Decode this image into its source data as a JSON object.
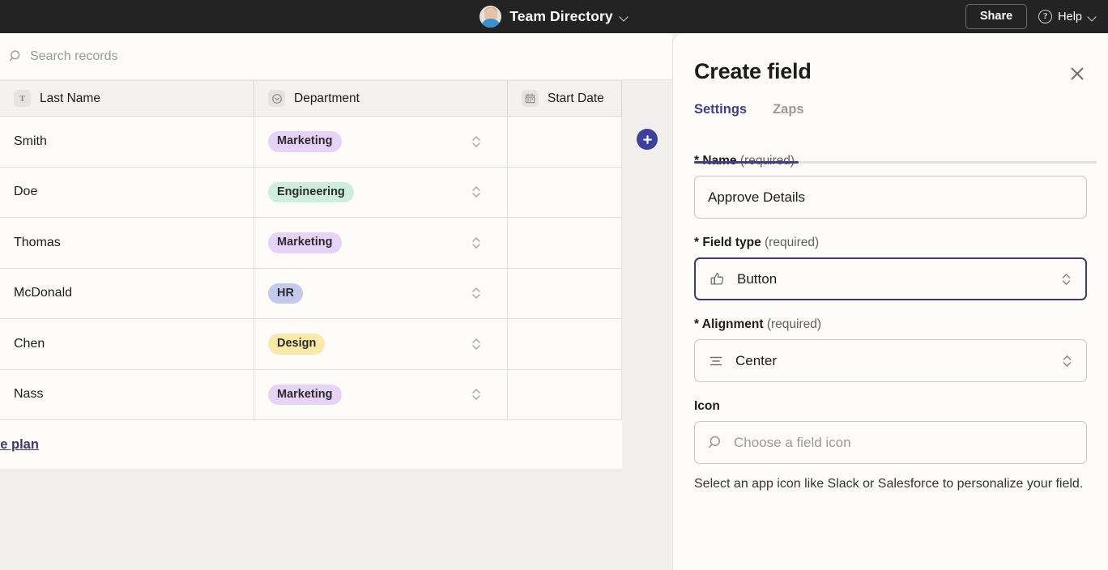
{
  "topbar": {
    "avatar_name": "avatar",
    "doc_title": "Team Directory",
    "title_caret_icon": "chevron-down-icon",
    "share_label": "Share",
    "help_label": "Help",
    "help_icon": "question-circle-icon",
    "help_caret_icon": "chevron-down-icon",
    "bg_color": "#232323"
  },
  "workspace": {
    "search": {
      "icon": "search-icon",
      "placeholder": "Search records",
      "value": ""
    },
    "add_field_button": {
      "icon": "plus-icon",
      "label": "",
      "color": "#3f3f9e"
    },
    "table": {
      "columns": [
        {
          "label": "Last Name",
          "icon": "text-field-icon",
          "glyph": "T"
        },
        {
          "label": "Department",
          "icon": "single-select-icon",
          "glyph": ""
        },
        {
          "label": "Start Date",
          "icon": "calendar-icon",
          "glyph": ""
        }
      ],
      "rows": [
        {
          "last_name": "Smith",
          "department": "Marketing",
          "badge_bg": "#e7d3f7",
          "badge_fg": "#2c2c2c",
          "start_date": ""
        },
        {
          "last_name": "Doe",
          "department": "Engineering",
          "badge_bg": "#cdeedd",
          "badge_fg": "#2c2c2c",
          "start_date": ""
        },
        {
          "last_name": "Thomas",
          "department": "Marketing",
          "badge_bg": "#e7d3f7",
          "badge_fg": "#2c2c2c",
          "start_date": ""
        },
        {
          "last_name": "McDonald",
          "department": "HR",
          "badge_bg": "#c3caec",
          "badge_fg": "#2c2c2c",
          "start_date": ""
        },
        {
          "last_name": "Chen",
          "department": "Design",
          "badge_bg": "#fae9a8",
          "badge_fg": "#2c2c2c",
          "start_date": ""
        },
        {
          "last_name": "Nass",
          "department": "Marketing",
          "badge_bg": "#e7d3f7",
          "badge_fg": "#2c2c2c",
          "start_date": ""
        }
      ],
      "upgrade_link": "ade plan"
    }
  },
  "panel": {
    "title": "Create field",
    "close_icon": "close-icon",
    "tabs": [
      {
        "label": "Settings",
        "active": true
      },
      {
        "label": "Zaps",
        "active": false
      }
    ],
    "accent_color": "#3f3f8e",
    "fields": {
      "name": {
        "label_bold": "* Name",
        "label_hint": "(required)",
        "value": "Approve Details",
        "placeholder": ""
      },
      "field_type": {
        "label_bold": "* Field type",
        "label_hint": "(required)",
        "value": "Button",
        "icon": "thumbs-up-icon",
        "caret_icon": "chevron-updown-icon",
        "focused": true
      },
      "alignment": {
        "label_bold": "* Alignment",
        "label_hint": "(required)",
        "value": "Center",
        "icon": "align-center-icon",
        "caret_icon": "chevron-updown-icon",
        "focused": false
      },
      "icon": {
        "label_bold": "Icon",
        "label_hint": "",
        "value": "",
        "placeholder": "Choose a field icon",
        "search_icon": "search-icon"
      }
    },
    "helper_text": "Select an app icon like Slack or Salesforce to personalize your field."
  }
}
